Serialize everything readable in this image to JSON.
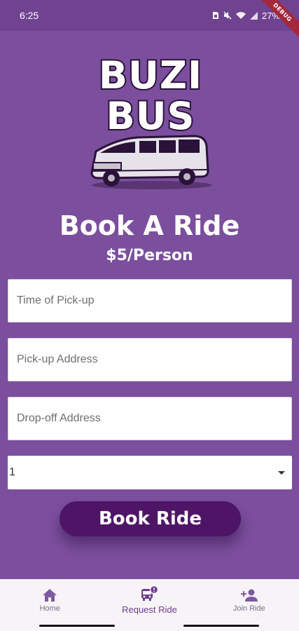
{
  "status_bar": {
    "time": "6:25",
    "battery": "27%",
    "icons": [
      "sim-icon",
      "mute-icon",
      "wifi-icon",
      "signal-icon",
      "battery-icon"
    ]
  },
  "debug_banner": "DEBUG",
  "logo": {
    "line1": "BUZI",
    "line2": "BUS",
    "icon": "van-icon"
  },
  "header": {
    "title": "Book A Ride",
    "price": "$5/Person"
  },
  "form": {
    "pickup_time_placeholder": "Time of Pick-up",
    "pickup_address_placeholder": "Pick-up Address",
    "dropoff_address_placeholder": "Drop-off Address",
    "passengers_value": "1"
  },
  "book_button": "Book Ride",
  "nav": {
    "items": [
      {
        "label": "Home",
        "icon": "home-icon"
      },
      {
        "label": "Request Ride",
        "icon": "bus-alert-icon",
        "active": true
      },
      {
        "label": "Join Ride",
        "icon": "add-person-icon"
      }
    ]
  },
  "colors": {
    "background": "#7b4f9d",
    "status_bar": "#6f4390",
    "button": "#4e1566",
    "nav_bg": "#f7f4f8",
    "nav_icon": "#7e5aa0"
  }
}
